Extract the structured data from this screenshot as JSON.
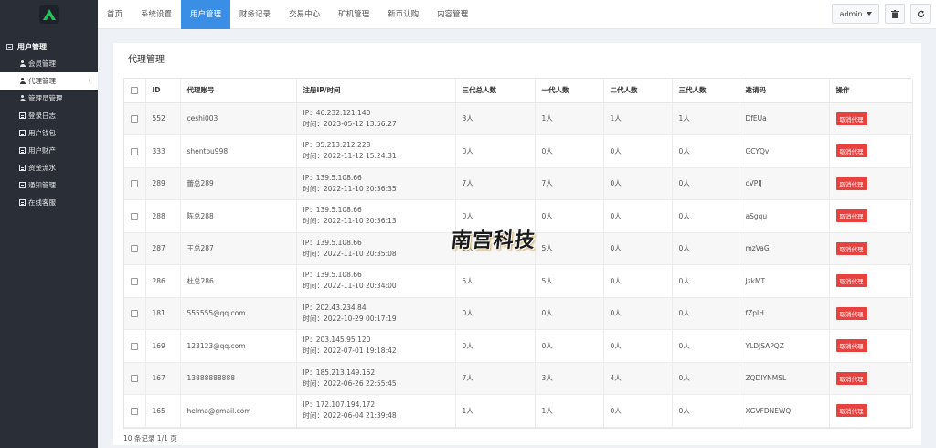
{
  "sidebar": {
    "group_label": "用户管理",
    "items": [
      {
        "label": "会员管理",
        "icon": "user-icon",
        "active": false
      },
      {
        "label": "代理管理",
        "icon": "user-icon",
        "active": true
      },
      {
        "label": "管理员管理",
        "icon": "user-icon",
        "active": false
      },
      {
        "label": "登录日志",
        "icon": "doc-icon",
        "active": false
      },
      {
        "label": "用户钱包",
        "icon": "doc-icon",
        "active": false
      },
      {
        "label": "用户财产",
        "icon": "doc-icon",
        "active": false
      },
      {
        "label": "资金流水",
        "icon": "doc-icon",
        "active": false
      },
      {
        "label": "通知管理",
        "icon": "doc-icon",
        "active": false
      },
      {
        "label": "在线客服",
        "icon": "doc-icon",
        "active": false
      }
    ]
  },
  "nav": {
    "items": [
      "首页",
      "系统设置",
      "用户管理",
      "财务记录",
      "交易中心",
      "矿机管理",
      "新币认购",
      "内容管理"
    ],
    "active_index": 2
  },
  "toolbar": {
    "admin_label": "admin"
  },
  "panel": {
    "title": "代理管理"
  },
  "table": {
    "headers": [
      "ID",
      "代理账号",
      "注册IP/时间",
      "三代总人数",
      "一代人数",
      "二代人数",
      "三代人数",
      "邀请码",
      "操作"
    ],
    "rows": [
      {
        "id": "552",
        "account": "ceshi003",
        "ip": "IP：46.232.121.140",
        "time": "时间：2023-05-12 13:56:27",
        "total": "3人",
        "g1": "1人",
        "g2": "1人",
        "g3": "1人",
        "code": "DfEUa",
        "action": "取消代理"
      },
      {
        "id": "333",
        "account": "shentou998",
        "ip": "IP：35.213.212.228",
        "time": "时间：2022-11-12 15:24:31",
        "total": "0人",
        "g1": "0人",
        "g2": "0人",
        "g3": "0人",
        "code": "GCYQv",
        "action": "取消代理"
      },
      {
        "id": "289",
        "account": "蕾总289",
        "ip": "IP：139.5.108.66",
        "time": "时间：2022-11-10 20:36:35",
        "total": "7人",
        "g1": "7人",
        "g2": "0人",
        "g3": "0人",
        "code": "cVPIJ",
        "action": "取消代理"
      },
      {
        "id": "288",
        "account": "陈总288",
        "ip": "IP：139.5.108.66",
        "time": "时间：2022-11-10 20:36:13",
        "total": "0人",
        "g1": "0人",
        "g2": "0人",
        "g3": "0人",
        "code": "aSgqu",
        "action": "取消代理"
      },
      {
        "id": "287",
        "account": "王总287",
        "ip": "IP：139.5.108.66",
        "time": "时间：2022-11-10 20:35:08",
        "total": "5人",
        "g1": "5人",
        "g2": "0人",
        "g3": "0人",
        "code": "mzVaG",
        "action": "取消代理"
      },
      {
        "id": "286",
        "account": "杜总286",
        "ip": "IP：139.5.108.66",
        "time": "时间：2022-11-10 20:34:00",
        "total": "5人",
        "g1": "5人",
        "g2": "0人",
        "g3": "0人",
        "code": "JzkMT",
        "action": "取消代理"
      },
      {
        "id": "181",
        "account": "555555@qq.com",
        "ip": "IP：202.43.234.84",
        "time": "时间：2022-10-29 00:17:19",
        "total": "0人",
        "g1": "0人",
        "g2": "0人",
        "g3": "0人",
        "code": "fZpIH",
        "action": "取消代理"
      },
      {
        "id": "169",
        "account": "123123@qq.com",
        "ip": "IP：203.145.95.120",
        "time": "时间：2022-07-01 19:18:42",
        "total": "0人",
        "g1": "0人",
        "g2": "0人",
        "g3": "0人",
        "code": "YLDJSAPQZ",
        "action": "取消代理"
      },
      {
        "id": "167",
        "account": "13888888888",
        "ip": "IP：185.213.149.152",
        "time": "时间：2022-06-26 22:55:45",
        "total": "7人",
        "g1": "3人",
        "g2": "4人",
        "g3": "0人",
        "code": "ZQDIYNMSL",
        "action": "取消代理"
      },
      {
        "id": "165",
        "account": "helma@gmail.com",
        "ip": "IP：172.107.194.172",
        "time": "时间：2022-06-04 21:39:48",
        "total": "1人",
        "g1": "1人",
        "g2": "0人",
        "g3": "0人",
        "code": "XGVFDNEWQ",
        "action": "取消代理"
      }
    ]
  },
  "footer": {
    "count_text": "10 条记录 1/1 页"
  },
  "watermark": {
    "text": "南宫科技"
  },
  "colors": {
    "sidebar_bg": "#2a2f37",
    "nav_active": "#3a8ee6",
    "danger": "#e64340",
    "logo_green": "#21c25e"
  }
}
